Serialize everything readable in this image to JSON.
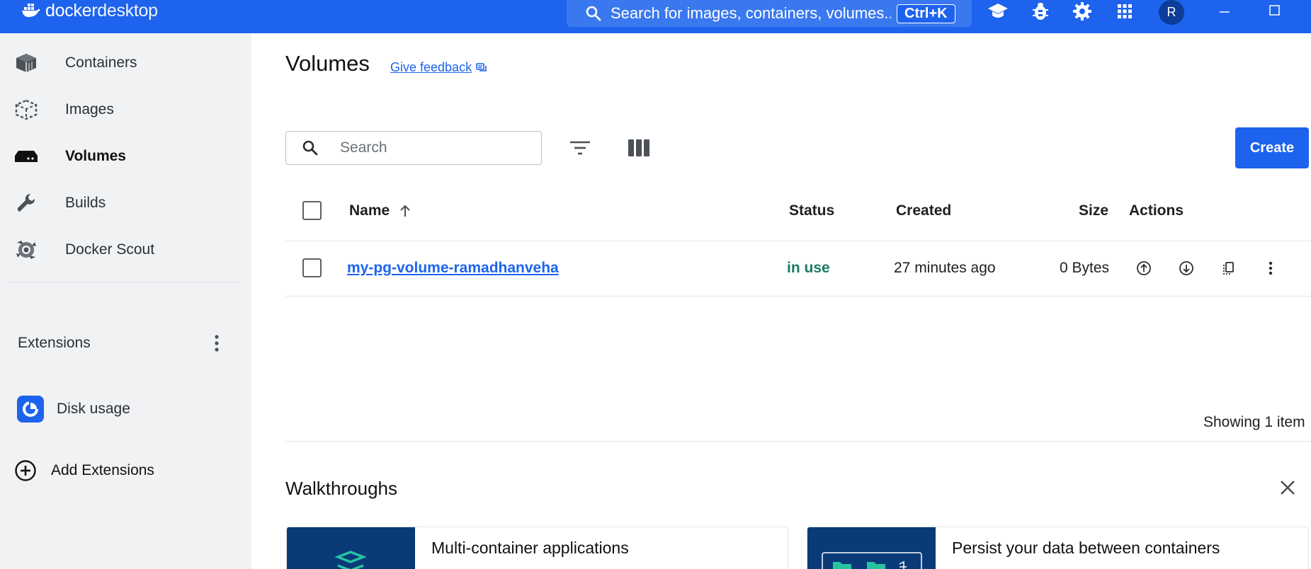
{
  "app": {
    "brand": {
      "bold": "docker",
      "light": " desktop"
    },
    "search": {
      "text": "Search for images, containers, volumes...",
      "shortcut": "Ctrl+K"
    },
    "top_icons": [
      "learning-center-icon",
      "troubleshoot-bug-icon",
      "settings-gear-icon",
      "apps-grid-icon"
    ],
    "avatar_initial": "R",
    "accent": "#1d63ed"
  },
  "sidebar": {
    "items": [
      {
        "label": "Containers",
        "icon": "containers-icon"
      },
      {
        "label": "Images",
        "icon": "images-icon"
      },
      {
        "label": "Volumes",
        "icon": "volumes-icon",
        "active": true
      },
      {
        "label": "Builds",
        "icon": "wrench-icon"
      },
      {
        "label": "Docker Scout",
        "icon": "scout-icon"
      }
    ],
    "extensions_label": "Extensions",
    "extensions": [
      {
        "label": "Disk usage",
        "icon": "disk-usage-icon"
      }
    ],
    "add_extensions": "Add Extensions"
  },
  "main": {
    "title": "Volumes",
    "feedback": "Give feedback",
    "search_placeholder": "Search",
    "create_label": "Create",
    "columns": {
      "name": "Name",
      "status": "Status",
      "created": "Created",
      "size": "Size",
      "actions": "Actions"
    },
    "rows": [
      {
        "name": "my-pg-volume-ramadhanveha",
        "status": "in use",
        "created": "27 minutes ago",
        "size": "0 Bytes"
      }
    ],
    "showing": "Showing 1 item",
    "walkthroughs": {
      "title": "Walkthroughs",
      "cards": [
        {
          "title": "Multi-container applications"
        },
        {
          "title": "Persist your data between containers"
        }
      ]
    }
  }
}
